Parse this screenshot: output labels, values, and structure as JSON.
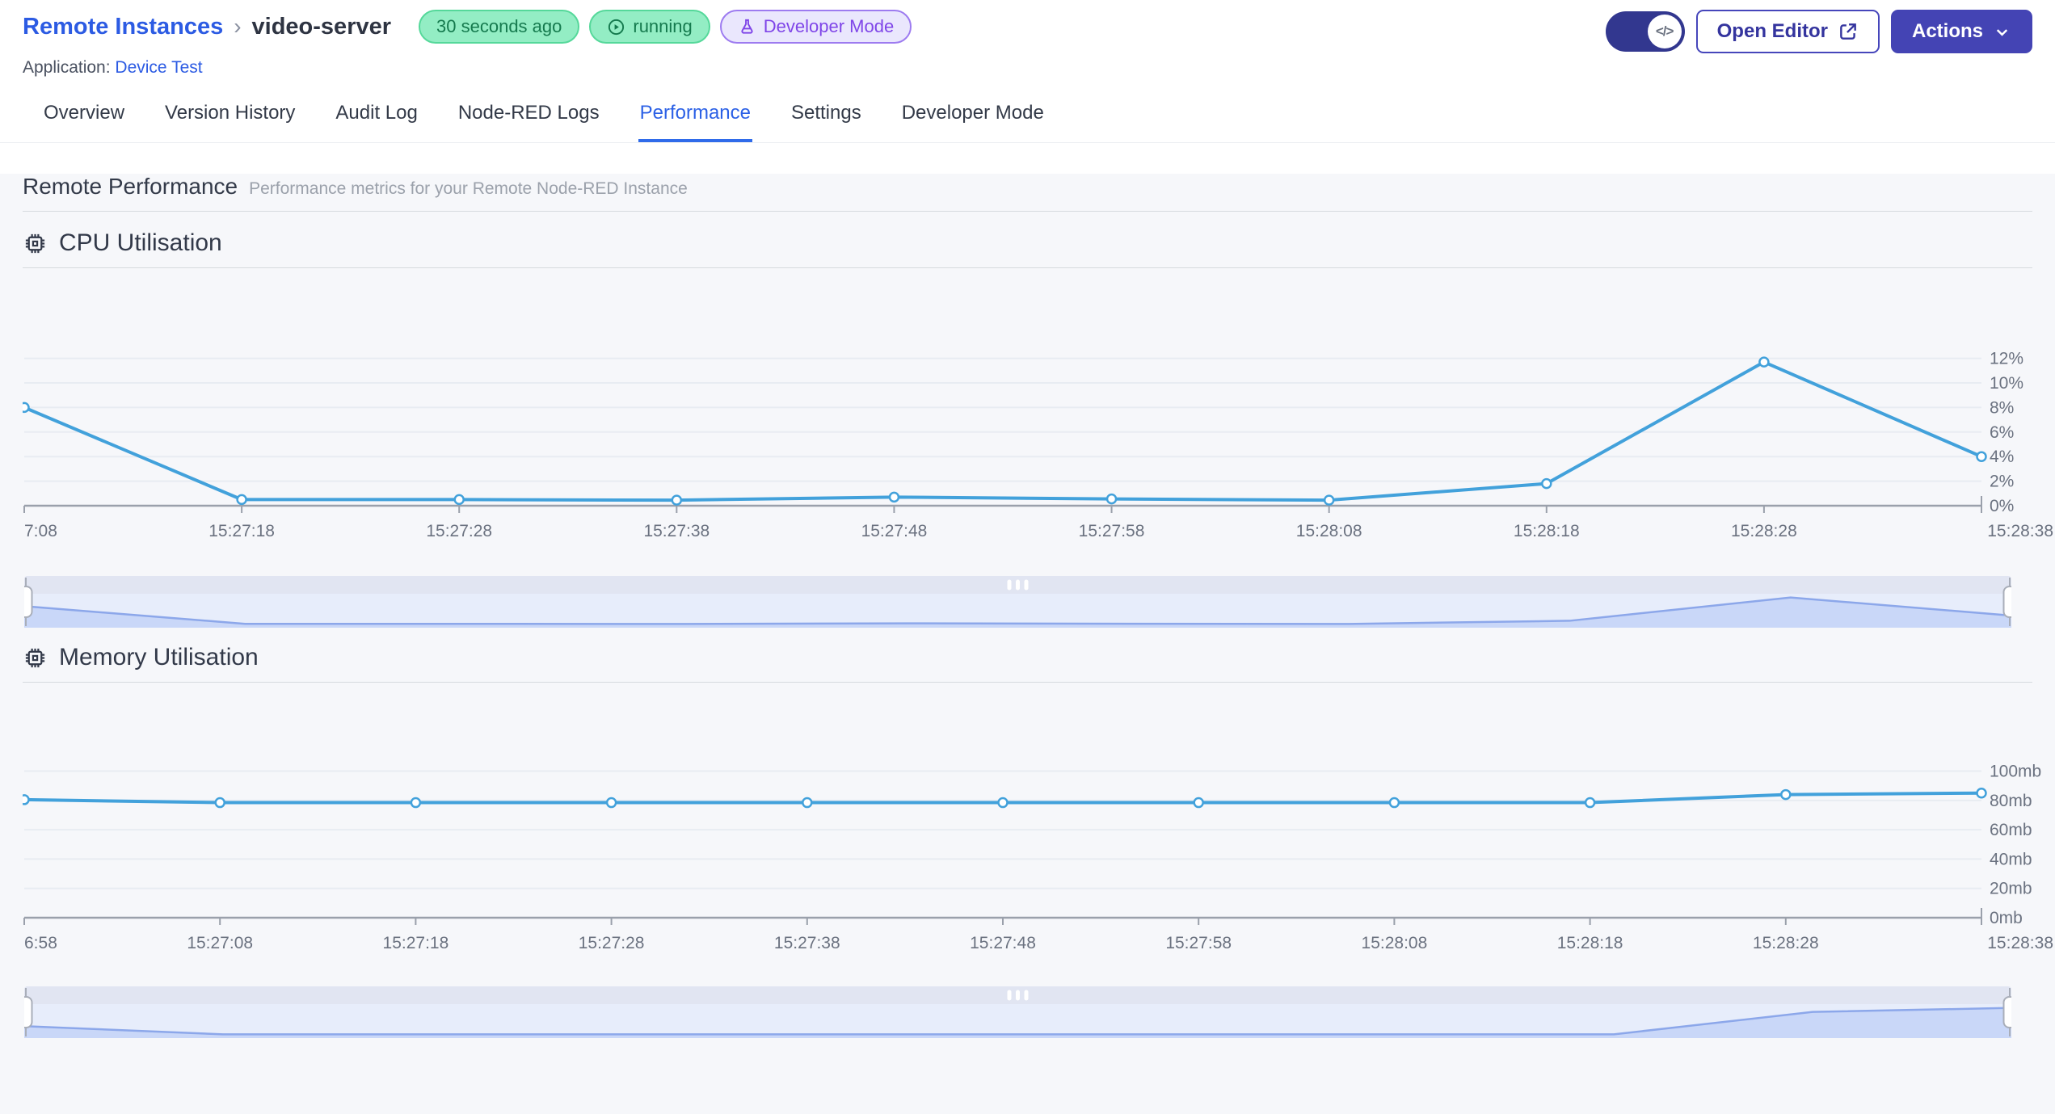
{
  "header": {
    "breadcrumb": {
      "parent": "Remote Instances",
      "separator": "›",
      "current": "video-server"
    },
    "badges": [
      {
        "label": "30 seconds ago",
        "type": "green",
        "icon": "none"
      },
      {
        "label": "running",
        "type": "green",
        "icon": "play-circle-icon"
      },
      {
        "label": "Developer Mode",
        "type": "purple",
        "icon": "flask-icon"
      }
    ],
    "application": {
      "label": "Application:",
      "link": "Device Test"
    },
    "developer_toggle": {
      "state": "on",
      "knob_glyph": "</>"
    },
    "open_editor": {
      "label": "Open Editor",
      "icon": "external-link-icon"
    },
    "actions": {
      "label": "Actions",
      "icon": "chevron-down-icon"
    }
  },
  "tabs": {
    "items": [
      "Overview",
      "Version History",
      "Audit Log",
      "Node-RED Logs",
      "Performance",
      "Settings",
      "Developer Mode"
    ],
    "active": "Performance"
  },
  "page": {
    "title": "Remote Performance",
    "subtitle": "Performance metrics for your Remote Node-RED Instance"
  },
  "chart_data": [
    {
      "id": "cpu",
      "type": "line",
      "title": "CPU Utilisation",
      "icon": "cpu-chip-icon",
      "x": [
        "7:08",
        "15:27:18",
        "15:27:28",
        "15:27:38",
        "15:27:48",
        "15:27:58",
        "15:28:08",
        "15:28:18",
        "15:28:28",
        "15:28:38"
      ],
      "series": [
        {
          "name": "cpu-percent",
          "values": [
            8,
            0.5,
            0.5,
            0.45,
            0.7,
            0.55,
            0.45,
            1.8,
            11.7,
            4
          ]
        }
      ],
      "yticks": [
        0,
        2,
        4,
        6,
        8,
        10,
        12
      ],
      "ytick_labels": [
        "0%",
        "2%",
        "4%",
        "6%",
        "8%",
        "10%",
        "12%"
      ],
      "ylim": [
        0,
        15
      ],
      "unit": "%",
      "grid": true,
      "legend": "none",
      "ylabel_side": "right",
      "has_brush": true
    },
    {
      "id": "memory",
      "type": "line",
      "title": "Memory Utilisation",
      "icon": "cpu-chip-icon",
      "x": [
        "6:58",
        "15:27:08",
        "15:27:18",
        "15:27:28",
        "15:27:38",
        "15:27:48",
        "15:27:58",
        "15:28:08",
        "15:28:18",
        "15:28:28",
        "15:28:38"
      ],
      "series": [
        {
          "name": "memory-mb",
          "values": [
            80.5,
            78.5,
            78.5,
            78.5,
            78.5,
            78.5,
            78.5,
            78.5,
            78.5,
            84,
            85
          ]
        }
      ],
      "yticks": [
        0,
        20,
        40,
        60,
        80,
        100
      ],
      "ytick_labels": [
        "0mb",
        "20mb",
        "40mb",
        "60mb",
        "80mb",
        "100mb"
      ],
      "ylim": [
        0,
        124
      ],
      "unit": "mb",
      "grid": true,
      "legend": "none",
      "ylabel_side": "right",
      "has_brush": true
    }
  ],
  "colors": {
    "link_blue": "#2c5be3",
    "active_tab_blue": "#2c61e6",
    "chart_line": "#42a1db",
    "grid_line": "#e8ecf2",
    "axis_gray": "#9aa0ab",
    "tick_text": "#6b7280",
    "badge_green_bg": "#93edc4",
    "badge_green_border": "#55d89a",
    "badge_green_text": "#157a4e",
    "badge_purple_bg": "#eae7fd",
    "badge_purple_border": "#9d7bf0",
    "badge_purple_text": "#7f45e8",
    "button_indigo": "#4444b4",
    "toggle_bg": "#32378f",
    "brush_strip": "#e1e5f2",
    "brush_bg": "#e7edfb",
    "brush_fill": "#c9d7f8",
    "brush_line": "#8ca7ea",
    "content_bg": "#f6f7fa"
  }
}
